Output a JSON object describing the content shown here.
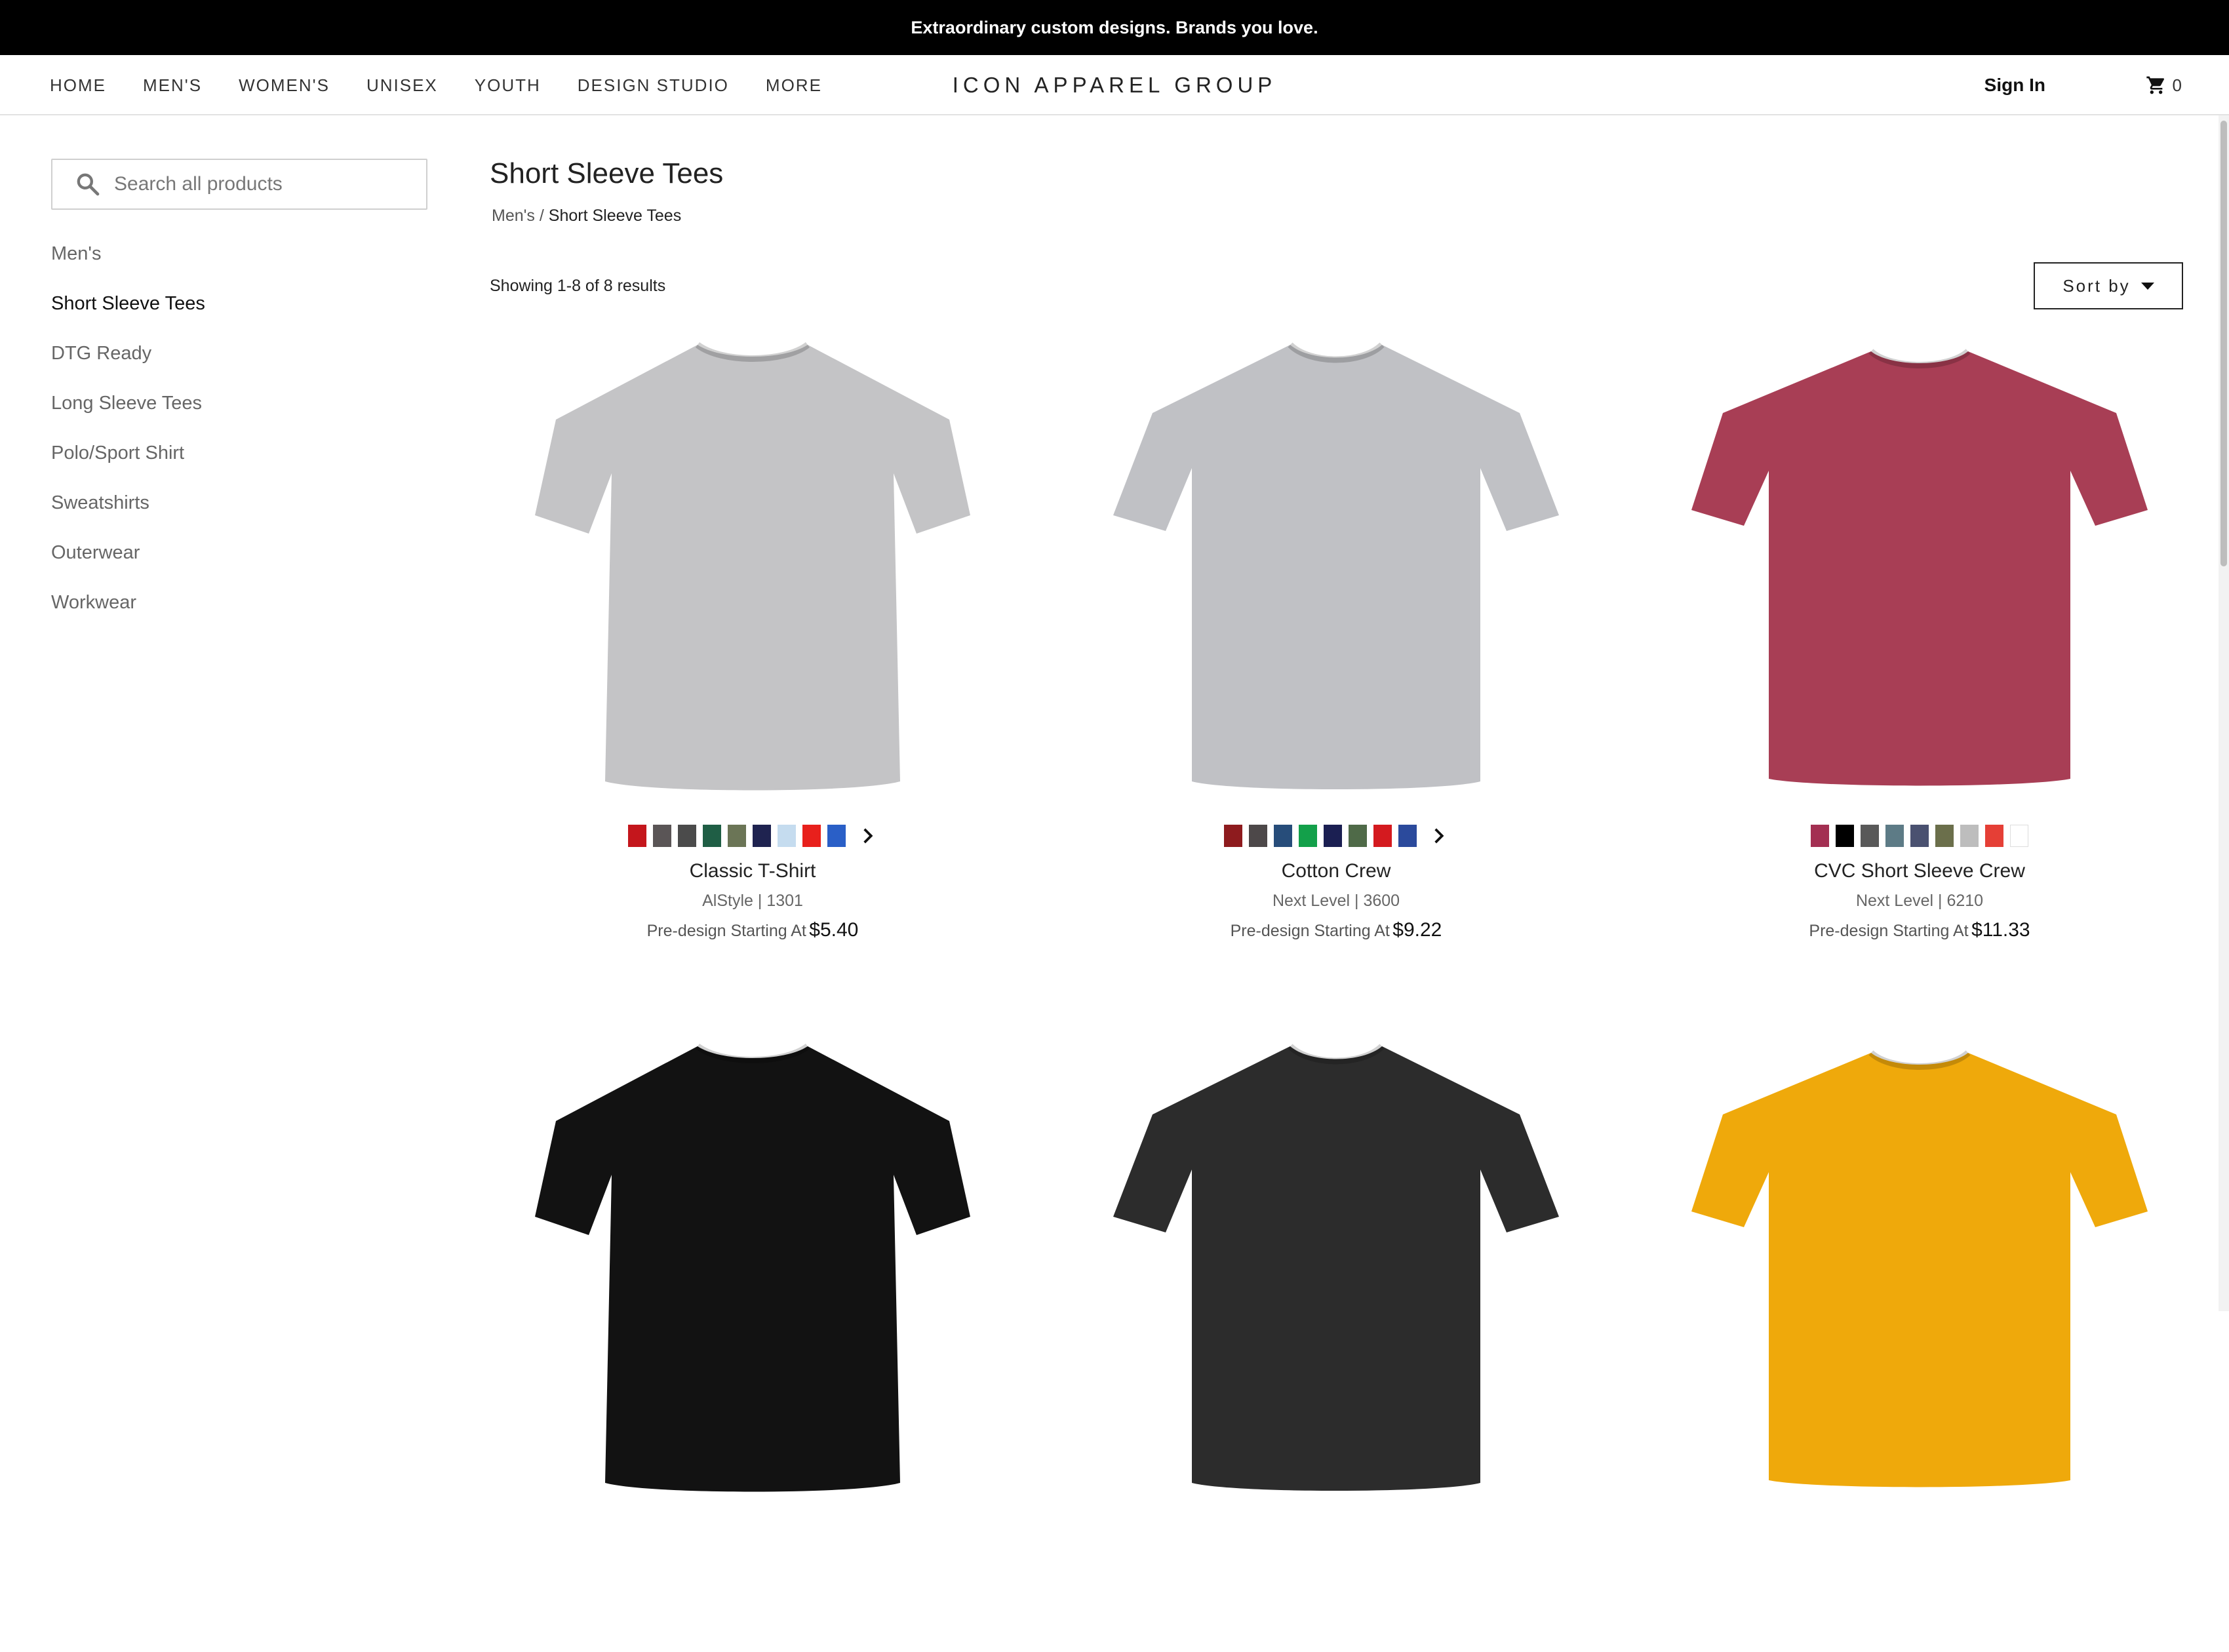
{
  "promo": {
    "text": "Extraordinary custom designs. Brands you love."
  },
  "header": {
    "nav": [
      "HOME",
      "MEN'S",
      "WOMEN'S",
      "UNISEX",
      "YOUTH",
      "DESIGN STUDIO",
      "MORE"
    ],
    "brand": "ICON APPAREL GROUP",
    "sign_in": "Sign In",
    "cart_icon": "cart-icon",
    "cart_count": "0"
  },
  "sidebar": {
    "search_placeholder": "Search all products",
    "search_value": "",
    "categories": [
      {
        "label": "Men's",
        "active": false
      },
      {
        "label": "Short Sleeve Tees",
        "active": true
      },
      {
        "label": "DTG Ready",
        "active": false
      },
      {
        "label": "Long Sleeve Tees",
        "active": false
      },
      {
        "label": "Polo/Sport Shirt",
        "active": false
      },
      {
        "label": "Sweatshirts",
        "active": false
      },
      {
        "label": "Outerwear",
        "active": false
      },
      {
        "label": "Workwear",
        "active": false
      }
    ]
  },
  "main": {
    "title": "Short Sleeve Tees",
    "breadcrumb": {
      "parent": "Men's",
      "separator": "/",
      "current": "Short Sleeve Tees"
    },
    "results_text": "Showing 1-8 of 8 results",
    "sort_label": "Sort by"
  },
  "products": [
    {
      "name": "Classic T-Shirt",
      "brand": "AlStyle | 1301",
      "price_prefix": "Pre-design Starting At",
      "price": "$5.40",
      "shirt_color": "#c4c4c6",
      "swatches": [
        "#c4161c",
        "#5a5556",
        "#4b4b4b",
        "#1f5e45",
        "#6b7556",
        "#1f2350",
        "#c5dcef",
        "#e8201c",
        "#2a5fc7"
      ]
    },
    {
      "name": "Cotton Crew",
      "brand": "Next Level | 3600",
      "price_prefix": "Pre-design Starting At",
      "price": "$9.22",
      "shirt_color": "#c0c1c5",
      "swatches": [
        "#8e1b1e",
        "#4d4849",
        "#274d7a",
        "#13a04a",
        "#1b1f52",
        "#4f6a48",
        "#d41a1f",
        "#2b4a9c"
      ]
    },
    {
      "name": "CVC Short Sleeve Crew",
      "brand": "Next Level | 6210",
      "price_prefix": "Pre-design Starting At",
      "price": "$11.33",
      "shirt_color": "#a83e55",
      "swatches": [
        "#a32f52",
        "#000000",
        "#595959",
        "#5d7b86",
        "#4a5170",
        "#6b6f4b",
        "#bdbdbd",
        "#e53f36",
        "#ffffff"
      ]
    },
    {
      "name": "",
      "brand": "",
      "price_prefix": "",
      "price": "",
      "shirt_color": "#121212",
      "swatches": []
    },
    {
      "name": "",
      "brand": "",
      "price_prefix": "",
      "price": "",
      "shirt_color": "#2c2c2c",
      "swatches": []
    },
    {
      "name": "",
      "brand": "",
      "price_prefix": "",
      "price": "",
      "shirt_color": "#efa90b",
      "swatches": []
    }
  ]
}
